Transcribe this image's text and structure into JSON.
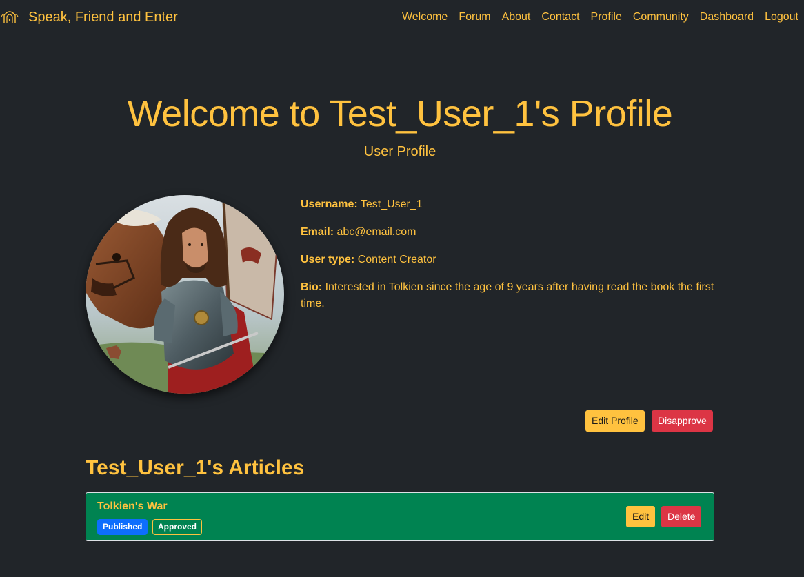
{
  "navbar": {
    "brand": "Speak, Friend and Enter",
    "links": [
      "Welcome",
      "Forum",
      "About",
      "Contact",
      "Profile",
      "Community",
      "Dashboard",
      "Logout"
    ]
  },
  "header": {
    "title": "Welcome to Test_User_1's Profile",
    "subtitle": "User Profile"
  },
  "profile": {
    "username_label": "Username:",
    "username": "Test_User_1",
    "email_label": "Email:",
    "email": "abc@email.com",
    "user_type_label": "User type:",
    "user_type": "Content Creator",
    "bio_label": "Bio:",
    "bio": "Interested in Tolkien since the age of 9 years after having read the book the first time."
  },
  "actions": {
    "edit_profile": "Edit Profile",
    "disapprove": "Disapprove"
  },
  "articles": {
    "heading": "Test_User_1's Articles",
    "items": [
      {
        "title": "Tolkien's War",
        "status_badge": "Published",
        "approval_badge": "Approved",
        "edit_label": "Edit",
        "delete_label": "Delete"
      }
    ]
  },
  "colors": {
    "background": "#212529",
    "accent": "#ffc23f",
    "danger": "#dc3545",
    "card_green": "#008351",
    "badge_blue": "#0d6efd"
  },
  "icons": {
    "brand_logo": "door-emblem-icon",
    "avatar": "warrior-with-horse-portrait"
  }
}
